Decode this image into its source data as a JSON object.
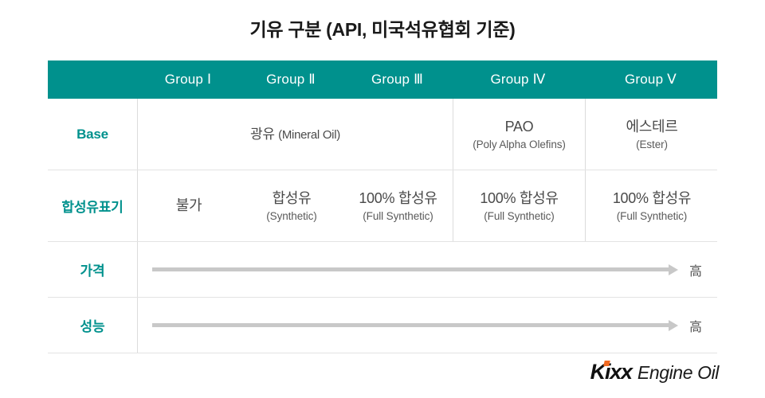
{
  "title": "기유 구분 (API, 미국석유협회 기준)",
  "table": {
    "header": {
      "corner_label": "",
      "columns": [
        {
          "label": "Group Ⅰ"
        },
        {
          "label": "Group Ⅱ"
        },
        {
          "label": "Group Ⅲ"
        },
        {
          "label": "Group Ⅳ"
        },
        {
          "label": "Group Ⅴ"
        }
      ]
    },
    "rows": [
      {
        "label": "Base",
        "cells": [
          {
            "main": "광유",
            "en": "(Mineral Oil)",
            "sub": ""
          },
          {
            "main": "PAO",
            "en": "",
            "sub": "(Poly Alpha Olefins)"
          },
          {
            "main": "에스테르",
            "en": "",
            "sub": "(Ester)"
          }
        ]
      },
      {
        "label": "합성유표기",
        "cells": [
          {
            "main": "불가",
            "en": "",
            "sub": ""
          },
          {
            "main": "합성유",
            "en": "",
            "sub": "(Synthetic)"
          },
          {
            "main": "100% 합성유",
            "en": "",
            "sub": "(Full Synthetic)"
          },
          {
            "main": "100% 합성유",
            "en": "",
            "sub": "(Full Synthetic)"
          },
          {
            "main": "100% 합성유",
            "en": "",
            "sub": "(Full Synthetic)"
          }
        ]
      },
      {
        "label": "가격",
        "arrow_end_label": "高"
      },
      {
        "label": "성능",
        "arrow_end_label": "高"
      }
    ]
  },
  "logo": {
    "mark": "Kixx",
    "word": "Engine Oil"
  },
  "colors": {
    "teal": "#00918d",
    "accent_orange": "#f26a21",
    "arrow_gray": "#c8c8c8",
    "text_dark": "#4a4a4a"
  }
}
